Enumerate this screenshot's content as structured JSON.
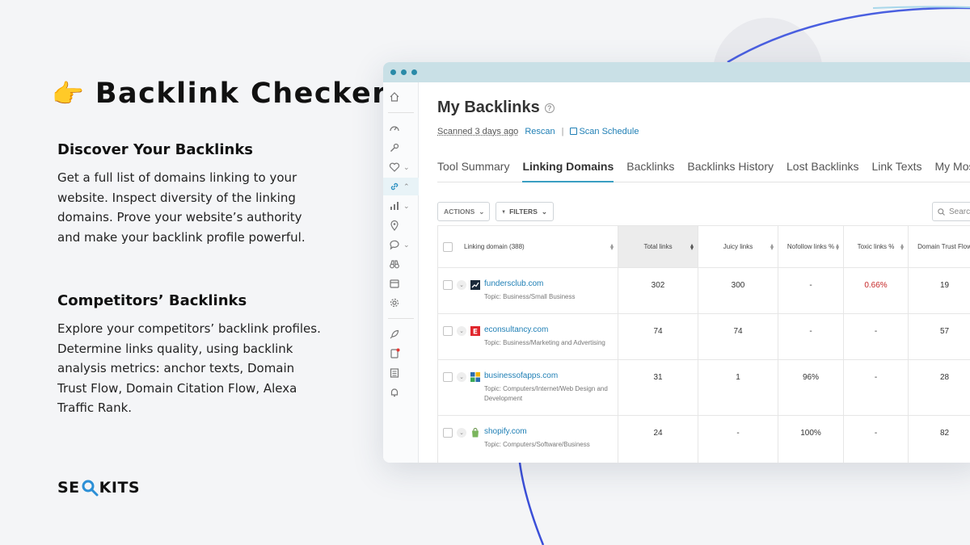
{
  "hero": {
    "emoji": "👉",
    "title": "Backlink Checker"
  },
  "sections": [
    {
      "heading": "Discover Your Backlinks",
      "text": "Get a full list of domains linking to your website. Inspect diversity of the linking domains. Prove your website’s authority and make your backlink profile powerful."
    },
    {
      "heading": "Competitors’ Backlinks",
      "text": "Explore your competitors’ backlink profiles. Determine links quality, using backlink analysis metrics: anchor texts, Domain Trust Flow, Domain Citation Flow, Alexa Traffic Rank."
    }
  ],
  "logo": {
    "left": "SE",
    "right": "KITS"
  },
  "app": {
    "title": "My Backlinks",
    "help": "?",
    "scanned": "Scanned 3 days ago",
    "rescan": "Rescan",
    "separator": "|",
    "scan_schedule": "Scan Schedule",
    "tabs": [
      "Tool Summary",
      "Linking Domains",
      "Backlinks",
      "Backlinks History",
      "Lost Backlinks",
      "Link Texts",
      "My Mos"
    ],
    "active_tab": "Linking Domains",
    "actions_label": "ACTIONS",
    "filters_label": "FILTERS",
    "search_placeholder": "Searc",
    "columns": [
      "Linking domain (388)",
      "Total links",
      "Juicy links",
      "Nofollow links %",
      "Toxic links %",
      "Domain Trust Flow"
    ],
    "rows": [
      {
        "domain": "fundersclub.com",
        "topic": "Topic: Business/Small Business",
        "total": "302",
        "juicy": "300",
        "nofollow": "-",
        "toxic": "0.66%",
        "trust": "19",
        "favicon": "chart-icon",
        "favicon_color": "#1b2a3a"
      },
      {
        "domain": "econsultancy.com",
        "topic": "Topic: Business/Marketing and Advertising",
        "total": "74",
        "juicy": "74",
        "nofollow": "-",
        "toxic": "-",
        "trust": "57",
        "favicon": "e-logo-icon",
        "favicon_color": "#e0262d"
      },
      {
        "domain": "businessofapps.com",
        "topic": "Topic: Computers/Internet/Web Design and Development",
        "total": "31",
        "juicy": "1",
        "nofollow": "96%",
        "toxic": "-",
        "trust": "28",
        "favicon": "grid-logo-icon",
        "favicon_color": "#2a6db0"
      },
      {
        "domain": "shopify.com",
        "topic": "Topic: Computers/Software/Business",
        "total": "24",
        "juicy": "-",
        "nofollow": "100%",
        "toxic": "-",
        "trust": "82",
        "favicon": "shopping-bag-icon",
        "favicon_color": "#7ab55c"
      }
    ]
  },
  "colors": {
    "accent": "#3a9ec2",
    "link": "#1f7fb5",
    "toxic": "#c62828",
    "titlebar": "#c9e0e6",
    "arc": "#3b4fd8"
  }
}
